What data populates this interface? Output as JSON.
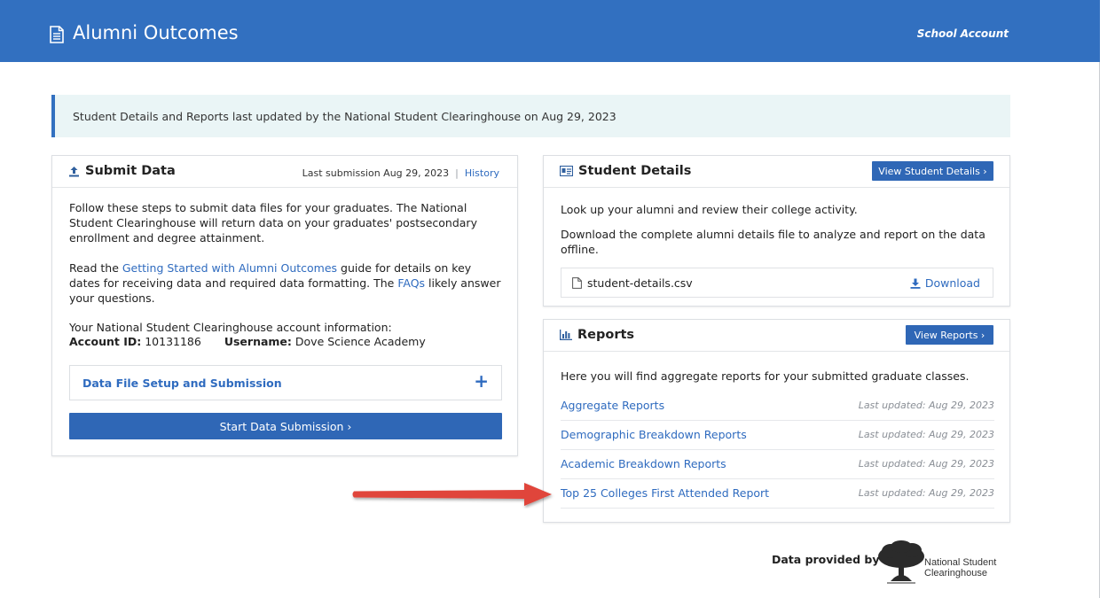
{
  "header": {
    "title": "Alumni Outcomes",
    "account_label": "School Account",
    "icon": "document-icon",
    "color": "#3270c0"
  },
  "banner": {
    "text": "Student Details and Reports last updated by the National Student Clearinghouse on Aug 29, 2023"
  },
  "submit_data": {
    "title": "Submit Data",
    "icon": "upload-icon",
    "last_submission": "Last submission Aug 29, 2023",
    "separator": "|",
    "history_link": "History",
    "para1": "Follow these steps to submit data files for your graduates. The National Student Clearinghouse will return data on your graduates' postsecondary enrollment and degree attainment.",
    "para2_pre": "Read the ",
    "para2_link": "Getting Started with Alumni Outcomes",
    "para2_mid": " guide for details on key dates for receiving data and required data formatting. The ",
    "para2_link2": "FAQs",
    "para2_post": " likely answer your questions.",
    "account_info": "Your National Student Clearinghouse account information:",
    "account_id_label": "Account ID:",
    "account_id": "10131186",
    "username_label": "Username:",
    "username": "Dove Science Academy",
    "accordion_label": "Data File Setup and Submission",
    "accordion_icon": "+",
    "start_button": "Start Data Submission ›"
  },
  "student_details": {
    "title": "Student Details",
    "icon": "id-card-icon",
    "view_button": "View Student Details ›",
    "para1": "Look up your alumni and review their college activity.",
    "para2": "Download the complete alumni details file to analyze and report on the data offline.",
    "file_name": "student-details.csv",
    "download_label": "Download"
  },
  "reports": {
    "title": "Reports",
    "icon": "bar-chart-icon",
    "view_button": "View Reports ›",
    "intro": "Here you will find aggregate reports for your submitted graduate classes.",
    "items": [
      {
        "label": "Aggregate Reports",
        "updated": "Last updated: Aug 29, 2023"
      },
      {
        "label": "Demographic Breakdown Reports",
        "updated": "Last updated: Aug 29, 2023"
      },
      {
        "label": "Academic Breakdown Reports",
        "updated": "Last updated: Aug 29, 2023"
      },
      {
        "label": "Top 25 Colleges First Attended Report",
        "updated": "Last updated: Aug 29, 2023"
      }
    ]
  },
  "footer": {
    "provided_by": "Data provided by",
    "org_line1": "National Student",
    "org_line2": "Clearinghouse"
  },
  "colors": {
    "primary": "#3270c0",
    "link": "#2f6bbf",
    "banner_bg": "#eaf5f6",
    "arrow": "#e0443a"
  }
}
